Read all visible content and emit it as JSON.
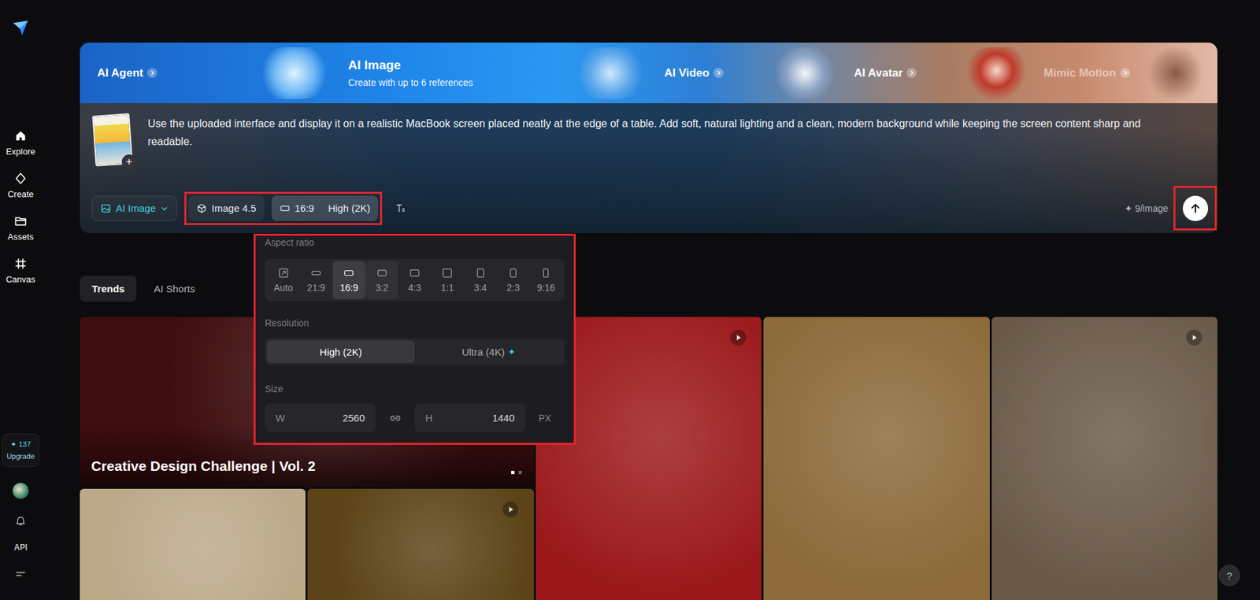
{
  "sidebar": {
    "items": [
      {
        "label": "Explore"
      },
      {
        "label": "Create"
      },
      {
        "label": "Assets"
      },
      {
        "label": "Canvas"
      }
    ],
    "credits": {
      "icon": "✦",
      "count": "137",
      "action": "Upgrade"
    },
    "footer": {
      "api": "API"
    }
  },
  "banner": {
    "items": [
      {
        "label": "AI Agent",
        "selected": false,
        "dimmed": false
      },
      {
        "label": "AI Image",
        "subtitle": "Create with up to 6 references",
        "selected": true,
        "dimmed": false
      },
      {
        "label": "AI Video",
        "selected": false,
        "dimmed": false
      },
      {
        "label": "AI Avatar",
        "selected": false,
        "dimmed": false
      },
      {
        "label": "Mimic Motion",
        "selected": false,
        "dimmed": true
      }
    ]
  },
  "composer": {
    "attachment": {
      "add": "+"
    },
    "prompt": "Use the uploaded interface and display it on a realistic MacBook screen placed neatly at the edge of a table. Add soft, natural lighting and a clean, modern background while keeping the screen content sharp and readable.",
    "mode": {
      "label": "AI Image"
    },
    "settings": {
      "highlighted": true,
      "model": "Image 4.5",
      "ratio": "16:9",
      "resolution": "High (2K)"
    },
    "cost": {
      "icon": "✦",
      "label": "9/image"
    },
    "send": {
      "highlighted": true
    }
  },
  "settings_popover": {
    "highlighted": true,
    "aspect_ratio": {
      "label": "Aspect ratio",
      "options": [
        {
          "label": "Auto",
          "kind": "auto",
          "selected": false,
          "hovered": false
        },
        {
          "label": "21:9",
          "kind": "ratio",
          "selected": false,
          "hovered": false
        },
        {
          "label": "16:9",
          "kind": "ratio",
          "selected": true,
          "hovered": false
        },
        {
          "label": "3:2",
          "kind": "ratio",
          "selected": false,
          "hovered": true
        },
        {
          "label": "4:3",
          "kind": "ratio",
          "selected": false,
          "hovered": false
        },
        {
          "label": "1:1",
          "kind": "ratio",
          "selected": false,
          "hovered": false
        },
        {
          "label": "3:4",
          "kind": "ratio",
          "selected": false,
          "hovered": false
        },
        {
          "label": "2:3",
          "kind": "ratio",
          "selected": false,
          "hovered": false
        },
        {
          "label": "9:16",
          "kind": "ratio",
          "selected": false,
          "hovered": false
        }
      ]
    },
    "resolution": {
      "label": "Resolution",
      "options": [
        {
          "label": "High (2K)",
          "selected": true
        },
        {
          "label": "Ultra (4K)",
          "selected": false,
          "badge": "✦"
        }
      ]
    },
    "size": {
      "label": "Size",
      "width": {
        "label": "W",
        "value": "2560"
      },
      "height": {
        "label": "H",
        "value": "1440"
      },
      "unit": "PX"
    }
  },
  "feed_tabs": [
    {
      "label": "Trends",
      "selected": true
    },
    {
      "label": "AI Shorts",
      "selected": false
    }
  ],
  "gallery": [
    {
      "kind": "feature",
      "caption": "Creative Design Challenge | Vol. 2",
      "video": false,
      "color": "#3e0d0f",
      "carousel": [
        {
          "selected": true
        },
        {
          "selected": false
        }
      ]
    },
    {
      "kind": "tall",
      "video": true,
      "color": "#9c1a1c"
    },
    {
      "kind": "tall",
      "video": false,
      "color": "#8c6a3a"
    },
    {
      "kind": "tall",
      "video": true,
      "color": "#6a5a49"
    },
    {
      "kind": "small",
      "video": false,
      "color": "#bca98a"
    },
    {
      "kind": "small",
      "video": true,
      "color": "#5c4418"
    }
  ],
  "help": {
    "label": "?"
  }
}
